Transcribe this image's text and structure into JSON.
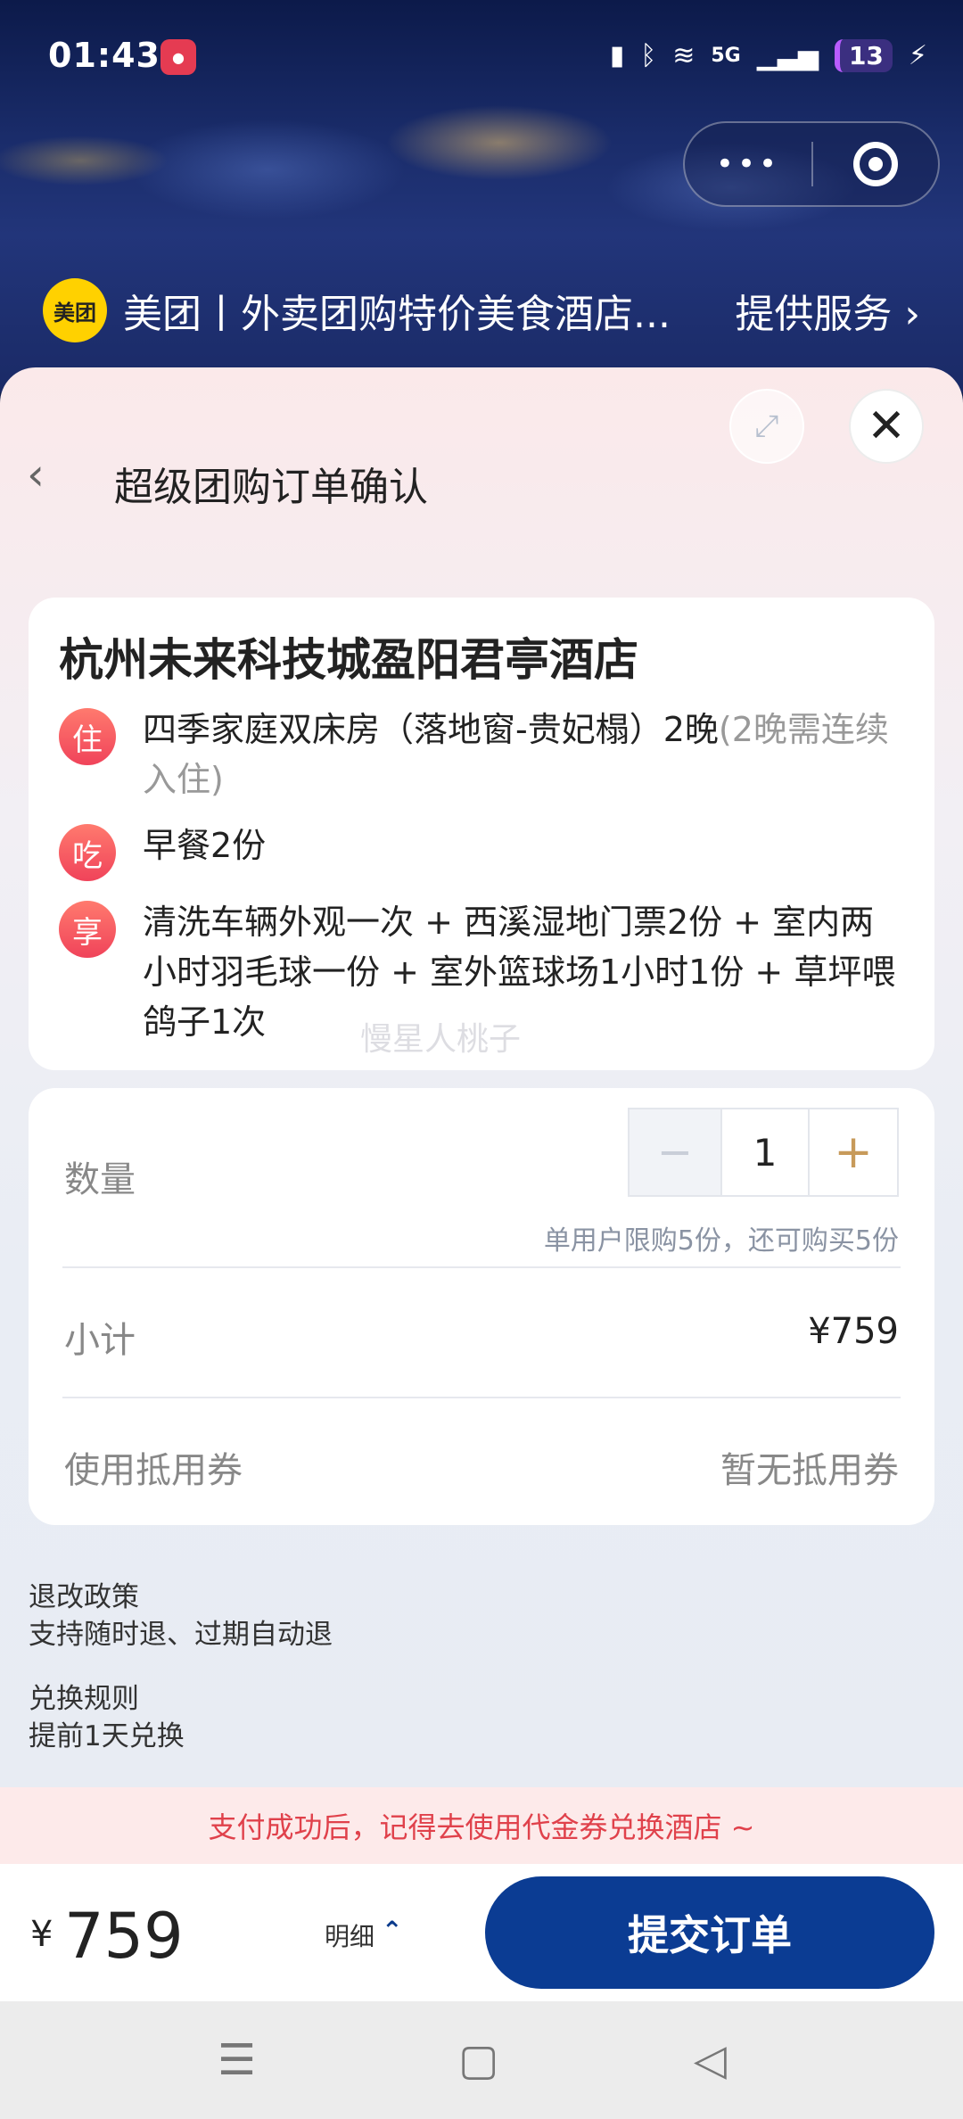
{
  "status_bar": {
    "time": "01:43",
    "network": "5G",
    "battery": "13"
  },
  "capsule": {
    "more": "•••"
  },
  "service": {
    "logo": "美团",
    "title": "美团丨外卖团购特价美食酒店...",
    "link": "提供服务 ›"
  },
  "sheet": {
    "title": "超级团购订单确认",
    "back_icon": "‹",
    "close_icon": "✕",
    "expand_icon": "⤢"
  },
  "hotel": {
    "name": "杭州未来科技城盈阳君亭酒店",
    "items": [
      {
        "icon": "住",
        "text": "四季家庭双床房（落地窗-贵妃榻）2晚",
        "note": "(2晚需连续入住)"
      },
      {
        "icon": "吃",
        "text": "早餐2份",
        "note": ""
      },
      {
        "icon": "享",
        "text": "清洗车辆外观一次 + 西溪湿地门票2份 + 室内两小时羽毛球一份 + 室外篮球场1小时1份 + 草坪喂鸽子1次",
        "note": ""
      }
    ],
    "watermark": "慢星人桃子"
  },
  "order": {
    "quantity_label": "数量",
    "quantity": "1",
    "minus": "−",
    "plus": "+",
    "limit_text": "单用户限购5份，还可购买5份",
    "subtotal_label": "小计",
    "subtotal_value": "¥759",
    "coupon_label": "使用抵用券",
    "coupon_value": "暂无抵用券"
  },
  "policies": [
    {
      "title": "退改政策",
      "text": "支持随时退、过期自动退"
    },
    {
      "title": "兑换规则",
      "text": "提前1天兑换"
    }
  ],
  "notice": "支付成功后，记得去使用代金券兑换酒店 ~",
  "bottom": {
    "currency": "¥",
    "total": "759",
    "detail": "明细",
    "detail_icon": "⌃",
    "submit": "提交订单"
  },
  "nav": {
    "menu": "☰",
    "home": "▢",
    "back": "◁"
  },
  "colors": {
    "submit_button": "#0b3c93",
    "notice_text": "#e0414b",
    "notice_bg": "#fdeaea",
    "icon_red": "#f0435a",
    "meituan_yellow": "#ffd100"
  }
}
